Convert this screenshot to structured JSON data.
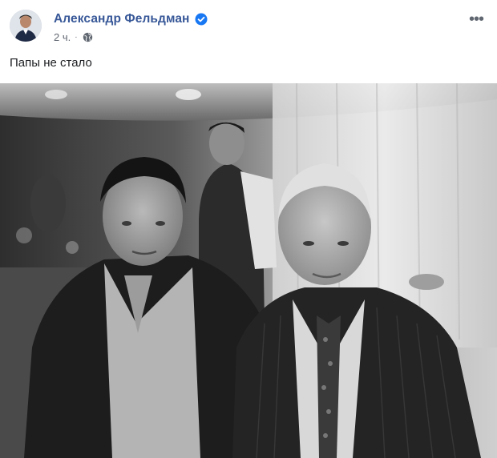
{
  "post": {
    "author_name": "Александр Фельдман",
    "timestamp": "2 ч.",
    "separator": "·",
    "text": "Папы не стало",
    "more_icon": "more-icon",
    "privacy_icon": "globe-icon",
    "verified_icon": "verified-badge-icon"
  },
  "colors": {
    "author": "#385898",
    "meta": "#606770",
    "verified": "#1877f2"
  }
}
